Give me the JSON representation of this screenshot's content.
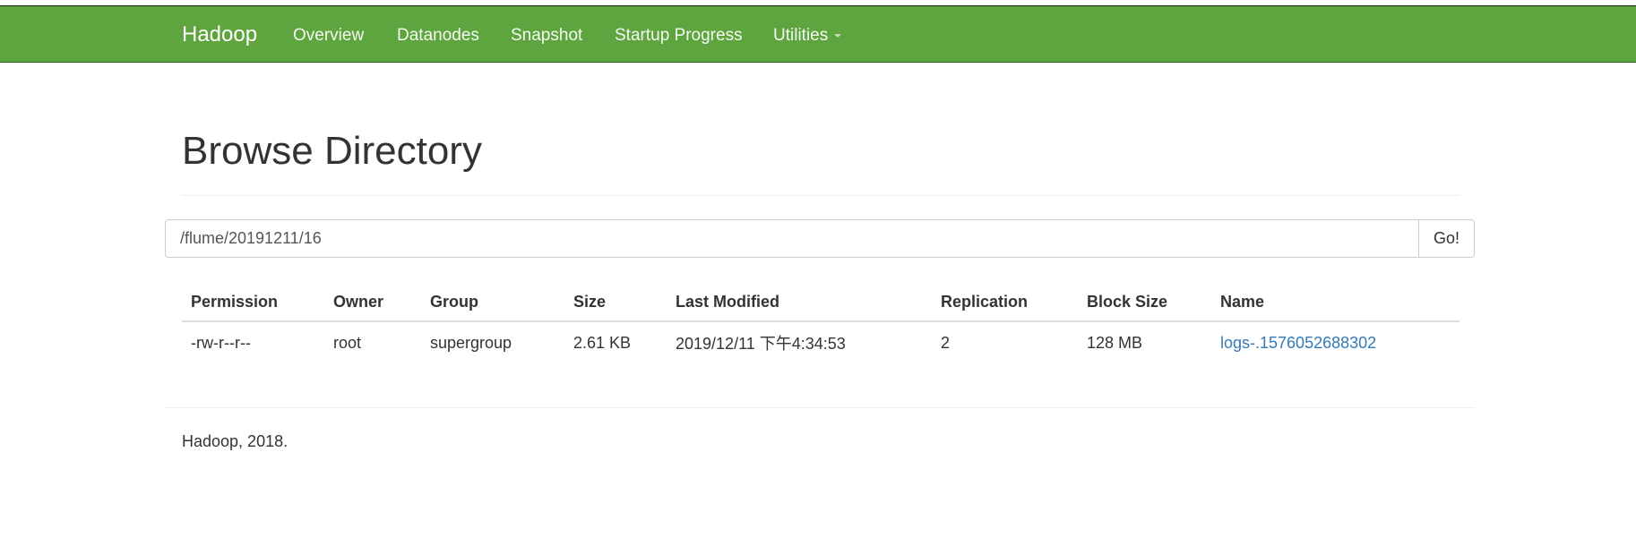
{
  "navbar": {
    "brand": "Hadoop",
    "links": [
      {
        "label": "Overview"
      },
      {
        "label": "Datanodes"
      },
      {
        "label": "Snapshot"
      },
      {
        "label": "Startup Progress"
      },
      {
        "label": "Utilities"
      }
    ],
    "background_color": "#5fa53f"
  },
  "page": {
    "title": "Browse Directory"
  },
  "path_bar": {
    "value": "/flume/20191211/16",
    "go_label": "Go!"
  },
  "table": {
    "headers": [
      "Permission",
      "Owner",
      "Group",
      "Size",
      "Last Modified",
      "Replication",
      "Block Size",
      "Name"
    ],
    "rows": [
      {
        "permission": "-rw-r--r--",
        "owner": "root",
        "group": "supergroup",
        "size": "2.61 KB",
        "last_modified": "2019/12/11 下午4:34:53",
        "replication": "2",
        "block_size": "128 MB",
        "name": "logs-.1576052688302"
      }
    ]
  },
  "footer": {
    "text": "Hadoop, 2018."
  },
  "colors": {
    "link": "#337ab7",
    "text": "#333333"
  }
}
